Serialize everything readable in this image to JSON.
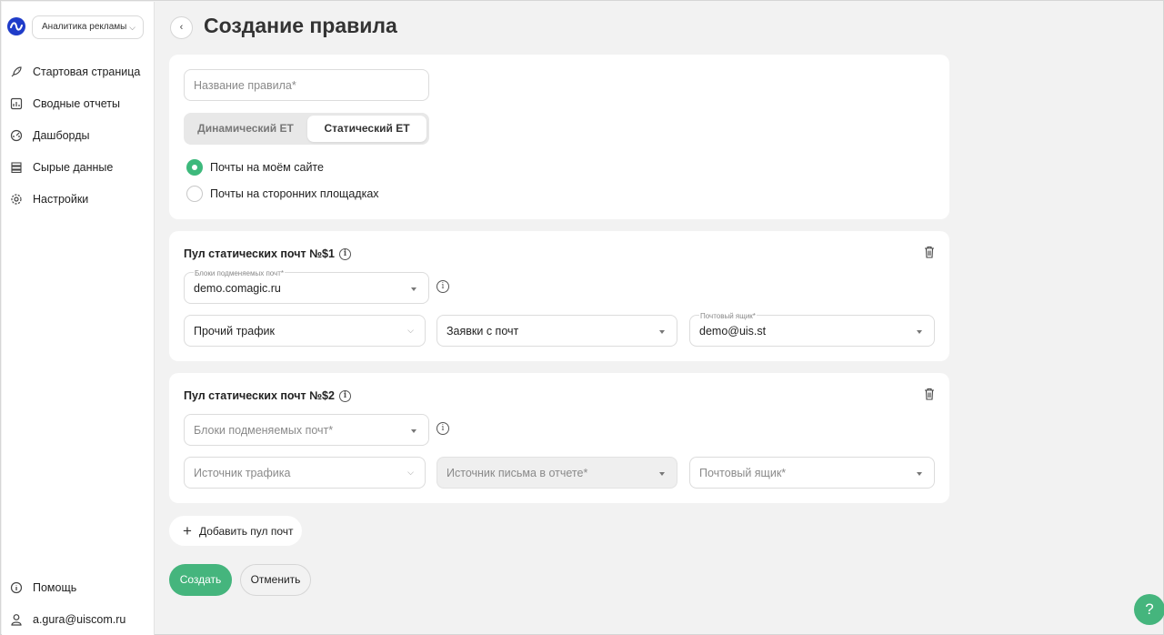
{
  "app": {
    "selector_label": "Аналитика рекламы"
  },
  "sidebar": {
    "items": [
      {
        "label": "Стартовая страница",
        "icon": "rocket-icon"
      },
      {
        "label": "Сводные отчеты",
        "icon": "report-icon"
      },
      {
        "label": "Дашборды",
        "icon": "dashboard-icon"
      },
      {
        "label": "Сырые данные",
        "icon": "database-icon"
      },
      {
        "label": "Настройки",
        "icon": "gear-icon"
      }
    ],
    "help_label": "Помощь",
    "user_email": "a.gura@uiscom.ru"
  },
  "header": {
    "title": "Создание правила"
  },
  "rule": {
    "name_placeholder": "Название правила*",
    "mode_tabs": [
      "Динамический ET",
      "Статический ET"
    ],
    "active_tab": "Статический ET",
    "radio_options": [
      "Почты на моём сайте",
      "Почты на сторонних площадках"
    ],
    "selected_radio": "Почты на моём сайте"
  },
  "pools": [
    {
      "title": "Пул статических почт №$1",
      "blocks_label": "Блоки подменяемых почт*",
      "blocks_value": "demo.comagic.ru",
      "traffic_value": "Прочий трафик",
      "source_value": "Заявки с почт",
      "mailbox_label": "Почтовый ящик*",
      "mailbox_value": "demo@uis.st"
    },
    {
      "title": "Пул статических почт №$2",
      "blocks_placeholder": "Блоки подменяемых почт*",
      "traffic_placeholder": "Источник трафика",
      "source_placeholder": "Источник письма в отчете*",
      "mailbox_placeholder": "Почтовый ящик*"
    }
  ],
  "actions": {
    "add_pool": "Добавить пул почт",
    "create": "Создать",
    "cancel": "Отменить",
    "help_fab": "?"
  },
  "colors": {
    "accent": "#45b57d",
    "logo": "#1f3cc9"
  }
}
